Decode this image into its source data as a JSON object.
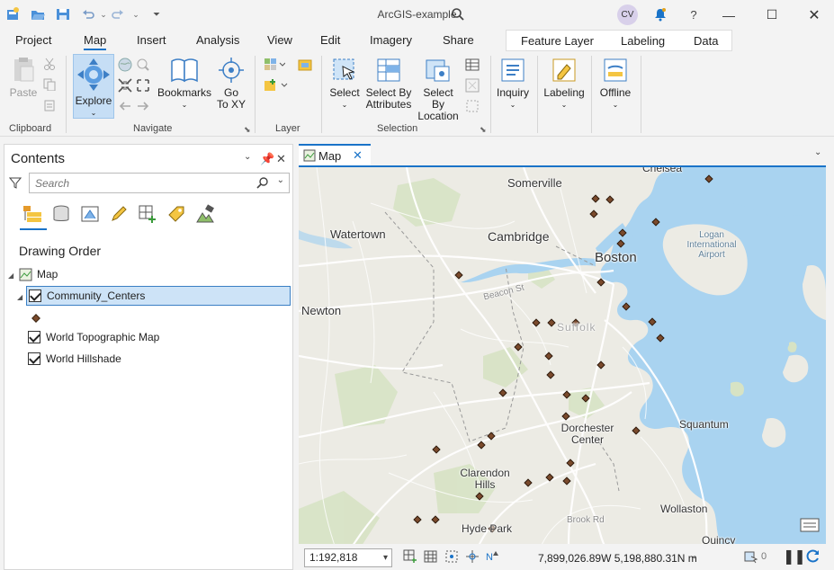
{
  "window": {
    "title": "ArcGIS-example",
    "user_initials": "CV",
    "help_glyph": "?"
  },
  "ribbon_tabs": [
    "Project",
    "Map",
    "Insert",
    "Analysis",
    "View",
    "Edit",
    "Imagery",
    "Share"
  ],
  "ribbon_active_tab": "Map",
  "context_tabs": [
    "Feature Layer",
    "Labeling",
    "Data"
  ],
  "ribbon": {
    "clipboard": {
      "paste": "Paste",
      "group": "Clipboard"
    },
    "navigate": {
      "explore": "Explore",
      "bookmarks": "Bookmarks",
      "goto_line1": "Go",
      "goto_line2": "To XY",
      "group": "Navigate"
    },
    "layer": {
      "group": "Layer"
    },
    "selection": {
      "select": "Select",
      "by_attr_1": "Select By",
      "by_attr_2": "Attributes",
      "by_loc_1": "Select By",
      "by_loc_2": "Location",
      "group": "Selection"
    },
    "inquiry": "Inquiry",
    "labeling": "Labeling",
    "offline": "Offline"
  },
  "contents": {
    "title": "Contents",
    "search_placeholder": "Search",
    "drawing_order_heading": "Drawing Order",
    "map_node": "Map",
    "layers": [
      "Community_Centers",
      "World Topographic Map",
      "World Hillshade"
    ],
    "selected_layer": "Community_Centers"
  },
  "map_view": {
    "tab_label": "Map",
    "scale": "1:192,818",
    "coordinates": "7,899,026.89W 5,198,880.31N m",
    "selected_count": "0",
    "places": [
      "Chelsea",
      "Somerville",
      "Watertown",
      "Cambridge",
      "Boston",
      "Newton",
      "Suffolk",
      "Squantum",
      "Dorchester Center",
      "Clarendon Hills",
      "Hyde Park",
      "Wollaston",
      "Quincy",
      "Logan International Airport"
    ],
    "roads": [
      "Beacon St",
      "Brook Rd"
    ],
    "colors": {
      "land": "#ecebe4",
      "water": "#a9d3f0",
      "park": "#d7e3c4",
      "point_fill": "#7a4a2c",
      "accent": "#1a73c8"
    }
  }
}
